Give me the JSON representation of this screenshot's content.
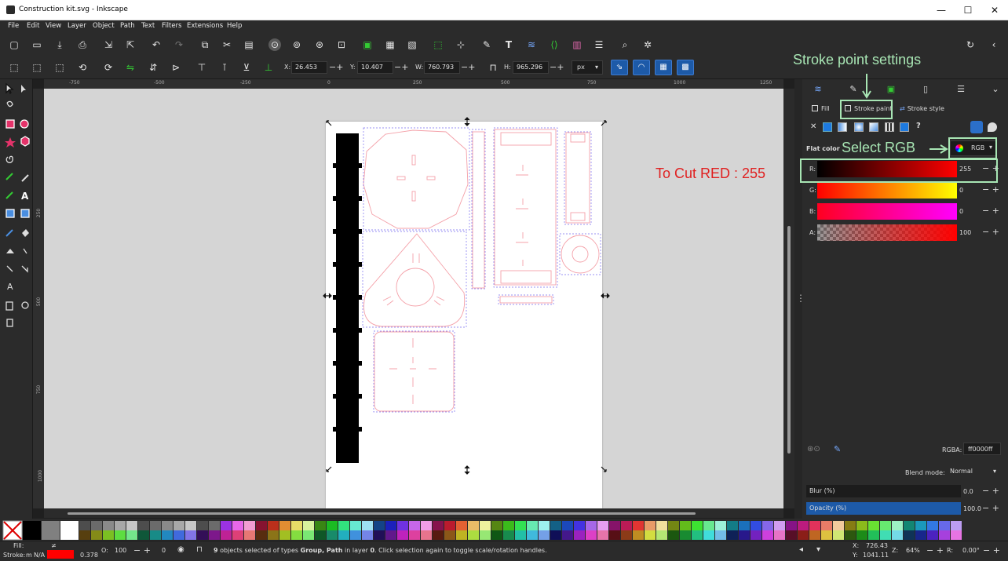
{
  "window": {
    "title": "Construction kit.svg - Inkscape",
    "controls": [
      "—",
      "☐",
      "✕"
    ]
  },
  "menu": [
    "File",
    "Edit",
    "View",
    "Layer",
    "Object",
    "Path",
    "Text",
    "Filters",
    "Extensions",
    "Help"
  ],
  "toolbar": {
    "x_label": "X:",
    "x_value": "26.453",
    "y_label": "Y:",
    "y_value": "10.407",
    "w_label": "W:",
    "w_value": "760.793",
    "h_label": "H:",
    "h_value": "965.296",
    "unit": "px"
  },
  "rulers": {
    "h_ticks": [
      "-750",
      "-500",
      "-250",
      "0",
      "250",
      "500",
      "750",
      "1000",
      "1250"
    ],
    "v_ticks": [
      "250",
      "500",
      "750",
      "1000"
    ]
  },
  "fill_stroke": {
    "tabs": {
      "fill": "Fill",
      "stroke_paint": "Stroke paint",
      "stroke_style": "Stroke style"
    },
    "flat_color": "Flat color",
    "mode": "RGB",
    "channels": [
      {
        "label": "R:",
        "value": "255"
      },
      {
        "label": "G:",
        "value": "0"
      },
      {
        "label": "B:",
        "value": "0"
      },
      {
        "label": "A:",
        "value": "100"
      }
    ],
    "rgba_label": "RGBA:",
    "rgba_value": "ff0000ff",
    "blend_label": "Blend mode:",
    "blend_value": "Normal",
    "blur_label": "Blur (%)",
    "blur_value": "0.0",
    "opacity_label": "Opacity (%)",
    "opacity_value": "100.0"
  },
  "annotations": {
    "stroke_settings": "Stroke point settings",
    "select_rgb": "Select RGB",
    "cut_red": "To Cut RED : 255"
  },
  "status": {
    "fill_label": "Fill:",
    "fill_value": "≠",
    "stroke_label": "Stroke:",
    "stroke_m": "m",
    "stroke_value": "N/A",
    "stroke_width": "0.378",
    "opacity_label": "O:",
    "opacity_value": "100",
    "layer_value": "0",
    "message_bold": "9",
    "message": " objects selected of types ",
    "types": "Group, Path",
    "message2": " in layer ",
    "layer": "0",
    "message3": ". Click selection again to toggle scale/rotation handles.",
    "x_label": "X:",
    "x_value": "726.43",
    "y_label": "Y:",
    "y_value": "1041.11",
    "zoom_label": "Z:",
    "zoom_value": "64%",
    "rot_label": "R:",
    "rot_value": "0.00°"
  },
  "colors": {
    "accent_blue": "#1d5aa8",
    "annotation_green": "#a8e6b4",
    "annotation_red": "#e02020",
    "stroke_red": "#ff0000"
  }
}
